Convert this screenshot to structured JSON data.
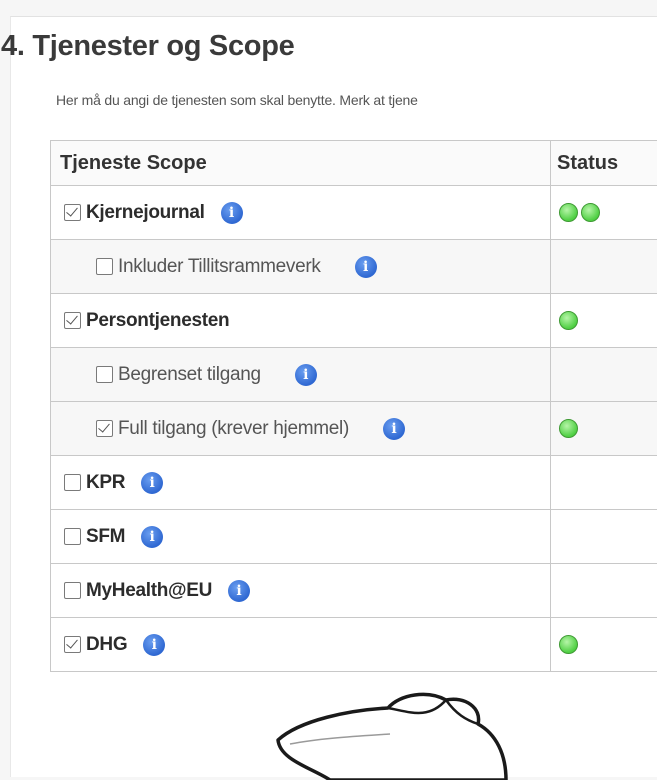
{
  "section": {
    "title": "4. Tjenester og Scope",
    "intro": "Her må du angi de tjenesten som skal benytte. Merk at tjene"
  },
  "table": {
    "headers": {
      "service": "Tjeneste Scope",
      "status": "Status"
    },
    "rows": [
      {
        "label": "Kjernejournal",
        "level": 0,
        "checked": true,
        "info": true,
        "status_dots": 2
      },
      {
        "label": "Inkluder Tillitsrammeverk",
        "level": 1,
        "checked": false,
        "info": true,
        "status_dots": 0
      },
      {
        "label": "Persontjenesten",
        "level": 0,
        "checked": true,
        "info": false,
        "status_dots": 1
      },
      {
        "label": "Begrenset tilgang",
        "level": 1,
        "checked": false,
        "info": true,
        "status_dots": 0
      },
      {
        "label": "Full tilgang (krever hjemmel)",
        "level": 1,
        "checked": true,
        "info": true,
        "status_dots": 1
      },
      {
        "label": "KPR",
        "level": 0,
        "checked": false,
        "info": true,
        "status_dots": 0
      },
      {
        "label": "SFM",
        "level": 0,
        "checked": false,
        "info": true,
        "status_dots": 0
      },
      {
        "label": "MyHealth@EU",
        "level": 0,
        "checked": false,
        "info": true,
        "status_dots": 0
      },
      {
        "label": "DHG",
        "level": 0,
        "checked": true,
        "info": true,
        "status_dots": 1
      }
    ]
  },
  "icons": {
    "info": "info-icon",
    "status": "status-ok-icon",
    "pointer": "pointing-hand-icon"
  },
  "colors": {
    "info_blue": "#2f68d2",
    "status_green": "#4fcf43"
  }
}
